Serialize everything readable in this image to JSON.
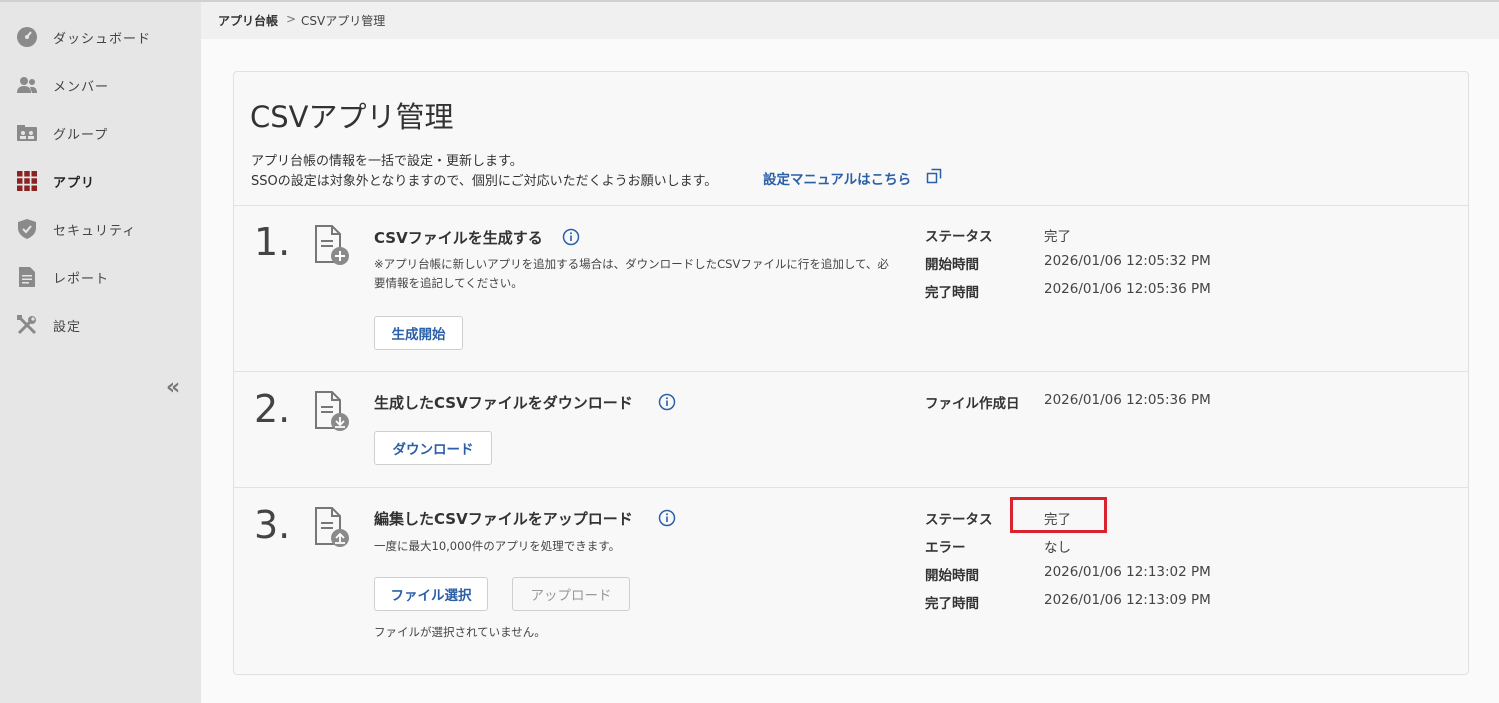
{
  "sidebar": {
    "items": [
      {
        "label": "ダッシュボード",
        "icon": "dashboard-icon"
      },
      {
        "label": "メンバー",
        "icon": "members-icon"
      },
      {
        "label": "グループ",
        "icon": "group-icon"
      },
      {
        "label": "アプリ",
        "icon": "apps-grid-icon",
        "active": true
      },
      {
        "label": "セキュリティ",
        "icon": "shield-icon"
      },
      {
        "label": "レポート",
        "icon": "report-icon"
      },
      {
        "label": "設定",
        "icon": "tools-icon"
      }
    ],
    "collapse_label": "«"
  },
  "breadcrumb": {
    "parent": "アプリ台帳",
    "separator": ">",
    "current": "CSVアプリ管理"
  },
  "page": {
    "title": "CSVアプリ管理",
    "description_line1": "アプリ台帳の情報を一括で設定・更新します。",
    "description_line2": "SSOの設定は対象外となりますので、個別にご対応いただくようお願いします。",
    "manual_link": "設定マニュアルはこちら"
  },
  "steps": [
    {
      "number": "1.",
      "title": "CSVファイルを生成する",
      "note": "※アプリ台帳に新しいアプリを追加する場合は、ダウンロードしたCSVファイルに行を追加して、必要情報を追記してください。",
      "button": "生成開始",
      "details": [
        {
          "key": "ステータス",
          "value": "完了"
        },
        {
          "key": "開始時間",
          "value": "2026/01/06 12:05:32 PM"
        },
        {
          "key": "完了時間",
          "value": "2026/01/06 12:05:36 PM"
        }
      ]
    },
    {
      "number": "2.",
      "title": "生成したCSVファイルをダウンロード",
      "button": "ダウンロード",
      "details": [
        {
          "key": "ファイル作成日",
          "value": "2026/01/06 12:05:36 PM"
        }
      ]
    },
    {
      "number": "3.",
      "title": "編集したCSVファイルをアップロード",
      "note": "一度に最大10,000件のアプリを処理できます。",
      "button_select": "ファイル選択",
      "button_upload": "アップロード",
      "file_status": "ファイルが選択されていません。",
      "details": [
        {
          "key": "ステータス",
          "value": "完了"
        },
        {
          "key": "エラー",
          "value": "なし"
        },
        {
          "key": "開始時間",
          "value": "2026/01/06 12:13:02 PM"
        },
        {
          "key": "完了時間",
          "value": "2026/01/06 12:13:09 PM"
        }
      ]
    }
  ],
  "colors": {
    "link": "#2b5fa8",
    "active_icon": "#8b2323",
    "highlight": "#d9232d"
  }
}
